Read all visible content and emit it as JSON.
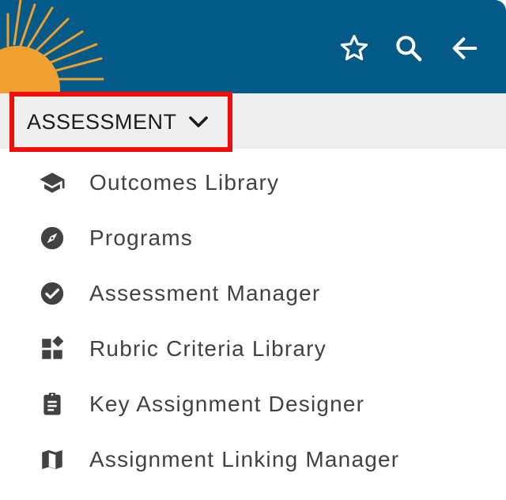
{
  "header": {
    "brand_color": "#045a87",
    "sun_color": "#f0a030",
    "actions": [
      {
        "name": "favorite",
        "icon": "star-outline-icon"
      },
      {
        "name": "search",
        "icon": "search-icon"
      },
      {
        "name": "back",
        "icon": "arrow-left-icon"
      }
    ]
  },
  "section": {
    "label": "ASSESSMENT",
    "icon": "chevron-down-icon",
    "highlight_color": "#f20d0d"
  },
  "menu": {
    "items": [
      {
        "label": "Outcomes Library",
        "icon": "graduation-cap-icon"
      },
      {
        "label": "Programs",
        "icon": "compass-icon"
      },
      {
        "label": "Assessment Manager",
        "icon": "check-circle-icon"
      },
      {
        "label": "Rubric Criteria Library",
        "icon": "widgets-icon"
      },
      {
        "label": "Key Assignment Designer",
        "icon": "clipboard-icon"
      },
      {
        "label": "Assignment Linking Manager",
        "icon": "map-icon"
      }
    ]
  }
}
